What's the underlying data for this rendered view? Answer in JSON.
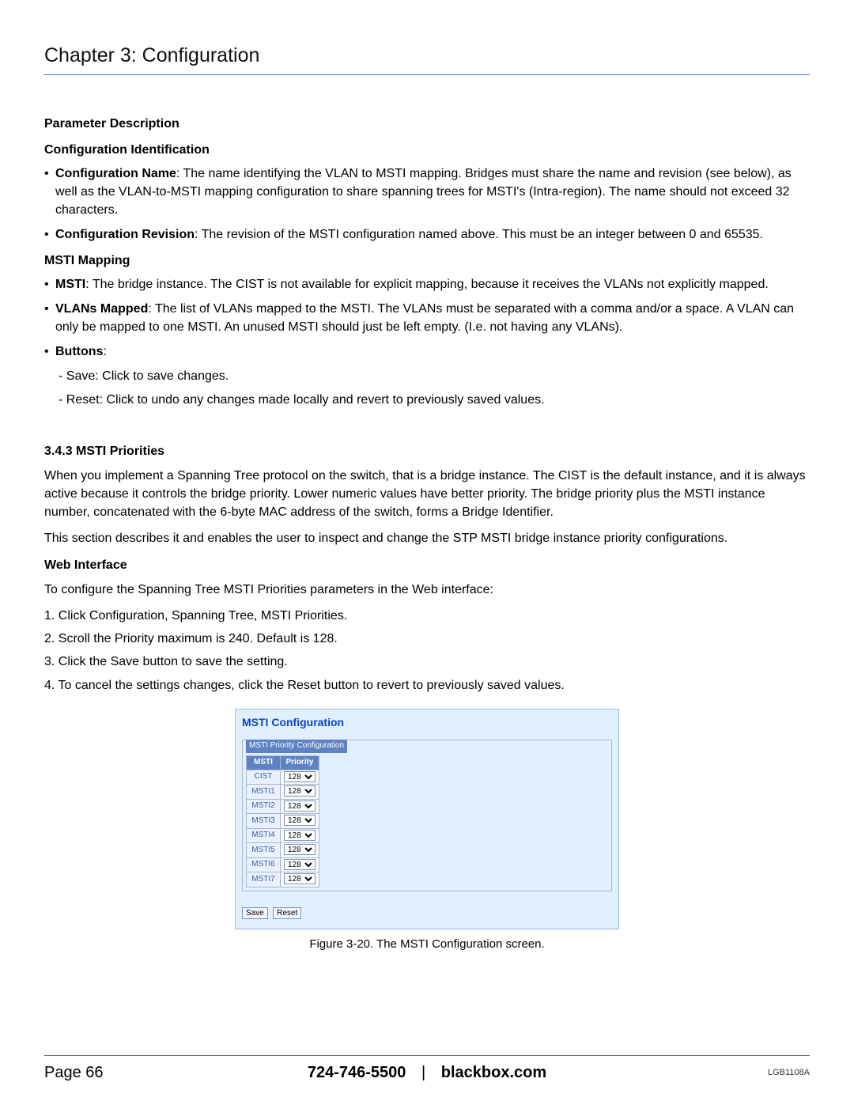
{
  "header": {
    "chapter_title": "Chapter 3: Configuration"
  },
  "section1": {
    "parameter_description": "Parameter Description",
    "config_ident": "Configuration Identification",
    "bullets": [
      {
        "term": "Configuration Name",
        "text": ": The name identifying the VLAN to MSTI mapping. Bridges must share the name and revision (see below), as well as the VLAN-to-MSTI mapping configuration to share spanning trees for MSTI's (Intra-region). The name should not exceed 32 characters."
      },
      {
        "term": "Configuration Revision",
        "text": ": The revision of the MSTI configuration named above. This must be an integer between 0 and 65535."
      }
    ],
    "msti_mapping_heading": "MSTI Mapping",
    "mapping_bullets": [
      {
        "term": "MSTI",
        "text": ": The bridge instance. The CIST is not available for explicit mapping, because it receives the VLANs not explicitly mapped."
      },
      {
        "term": "VLANs Mapped",
        "text": ": The list of VLANs mapped to the MSTI. The VLANs must be separated with a comma and/or a space. A VLAN can only be mapped to one MSTI. An unused MSTI should just be left empty. (I.e. not having any VLANs)."
      },
      {
        "term": "Buttons",
        "text": ":"
      }
    ],
    "sub_items": [
      "- Save: Click to save changes.",
      "- Reset: Click to undo any changes made locally and revert to previously saved values."
    ]
  },
  "section2": {
    "heading": "3.4.3 MSTI Priorities",
    "p1": "When you implement a Spanning Tree protocol on the switch, that is a bridge instance. The CIST is the default instance, and it is always active because it controls the bridge priority. Lower numeric values have better priority. The bridge priority plus the MSTI instance number, concatenated with the 6-byte MAC address of the switch, forms a Bridge Identifier.",
    "p2": "This section describes it and enables the user to inspect and change the STP MSTI bridge instance priority configurations.",
    "web_interface": "Web Interface",
    "intro": "To configure the Spanning Tree MSTI Priorities parameters in the Web interface:",
    "steps": [
      "1. Click Configuration, Spanning Tree, MSTI Priorities.",
      "2. Scroll the Priority maximum is 240. Default is 128.",
      "3. Click the Save button to save the setting.",
      "4. To cancel the settings changes, click the Reset button to revert to previously saved values."
    ]
  },
  "figure": {
    "title": "MSTI Configuration",
    "legend": "MSTI Priority Configuration",
    "col_msti": "MSTI",
    "col_priority": "Priority",
    "rows": [
      {
        "name": "CIST",
        "value": "128"
      },
      {
        "name": "MSTI1",
        "value": "128"
      },
      {
        "name": "MSTI2",
        "value": "128"
      },
      {
        "name": "MSTI3",
        "value": "128"
      },
      {
        "name": "MSTI4",
        "value": "128"
      },
      {
        "name": "MSTI5",
        "value": "128"
      },
      {
        "name": "MSTI6",
        "value": "128"
      },
      {
        "name": "MSTI7",
        "value": "128"
      }
    ],
    "save_label": "Save",
    "reset_label": "Reset",
    "caption": "Figure 3-20. The MSTI Configuration screen."
  },
  "footer": {
    "page_label": "Page 66",
    "phone": "724-746-5500",
    "site": "blackbox.com",
    "model": "LGB1108A"
  }
}
